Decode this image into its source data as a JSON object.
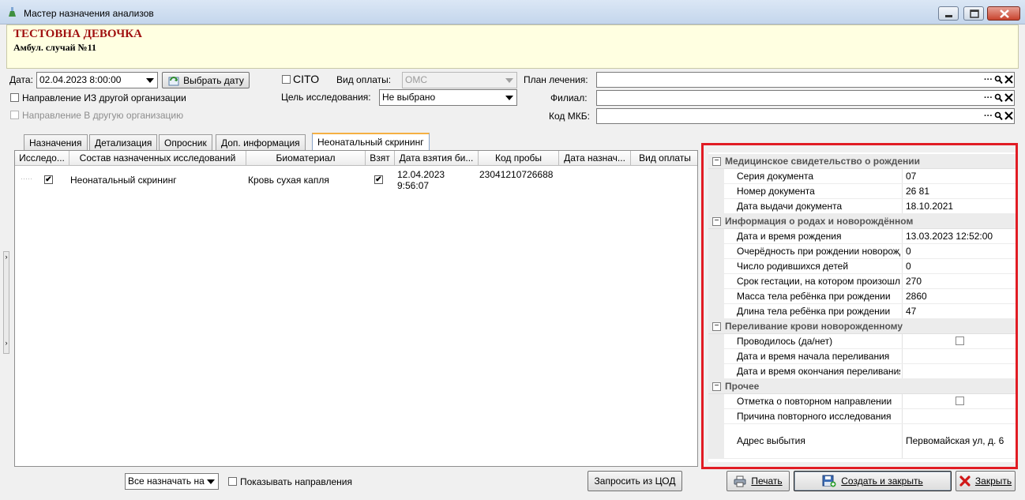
{
  "window": {
    "title": "Мастер назначения анализов"
  },
  "patient": {
    "name": "ТЕСТОВНА ДЕВОЧКА",
    "case": "Амбул. случай №11"
  },
  "form": {
    "date_label": "Дата:",
    "date_value": "02.04.2023 8:00:00",
    "choose_date_button": "Выбрать дату",
    "cito_label": "CITO",
    "payment_label": "Вид оплаты:",
    "payment_value": "ОМС",
    "direction_from_label": "Направление ИЗ другой организации",
    "direction_to_label": "Направление В другую организацию",
    "purpose_label": "Цель исследования:",
    "purpose_value": "Не выбрано",
    "plan_label": "План лечения:",
    "branch_label": "Филиал:",
    "mkb_label": "Код МКБ:",
    "dots": "···"
  },
  "tabs": [
    "Назначения",
    "Детализация",
    "Опросник",
    "Доп. информация",
    "Неонатальный скрининг"
  ],
  "grid": {
    "columns": [
      "Исследо...",
      "Состав назначенных исследований",
      "Биоматериал",
      "Взят",
      "Дата взятия би...",
      "Код пробы",
      "Дата назнач...",
      "Вид оплаты"
    ],
    "rows": [
      {
        "checked": "✔",
        "composition": "Неонатальный скрининг",
        "biomaterial": "Кровь сухая капля",
        "taken": "✔",
        "date_line1": "12.04.2023",
        "date_line2": "9:56:07",
        "code": "23041210726688",
        "assign_date": "",
        "payment": ""
      }
    ]
  },
  "properties": {
    "categories": [
      {
        "title": "Медицинское свидетельство о рождении",
        "items": [
          {
            "name": "Серия документа",
            "value": "07"
          },
          {
            "name": "Номер документа",
            "value": "26   81"
          },
          {
            "name": "Дата выдачи документа",
            "value": "18.10.2021"
          }
        ]
      },
      {
        "title": "Информация о родах и новорождённом",
        "items": [
          {
            "name": "Дата и время рождения",
            "value": "13.03.2023 12:52:00"
          },
          {
            "name": "Очерёдность при рождении новорожденного",
            "value": "0"
          },
          {
            "name": "Число родившихся детей",
            "value": "0"
          },
          {
            "name": "Срок гестации, на котором произошли роды",
            "value": "270"
          },
          {
            "name": "Масса тела ребёнка при рождении",
            "value": "2860"
          },
          {
            "name": "Длина тела ребёнка при рождении",
            "value": "47"
          }
        ]
      },
      {
        "title": "Переливание крови новорожденному",
        "items": [
          {
            "name": "Проводилось (да/нет)",
            "value": ""
          },
          {
            "name": "Дата и время начала переливания",
            "value": ""
          },
          {
            "name": "Дата и время окончания переливания",
            "value": ""
          }
        ]
      },
      {
        "title": "Прочее",
        "items": [
          {
            "name": "Отметка о повторном направлении",
            "value": ""
          },
          {
            "name": "Причина повторного исследования",
            "value": ""
          },
          {
            "name": "Адрес выбытия",
            "value": "Первомайская ул, д. 6"
          }
        ]
      }
    ]
  },
  "bottom": {
    "assign_all_value": "Все назначать на",
    "show_directions_label": "Показывать направления",
    "request_button": "Запросить из ЦОД",
    "print_button": "Печать",
    "create_close_button": "Создать и закрыть",
    "close_button": "Закрыть"
  }
}
